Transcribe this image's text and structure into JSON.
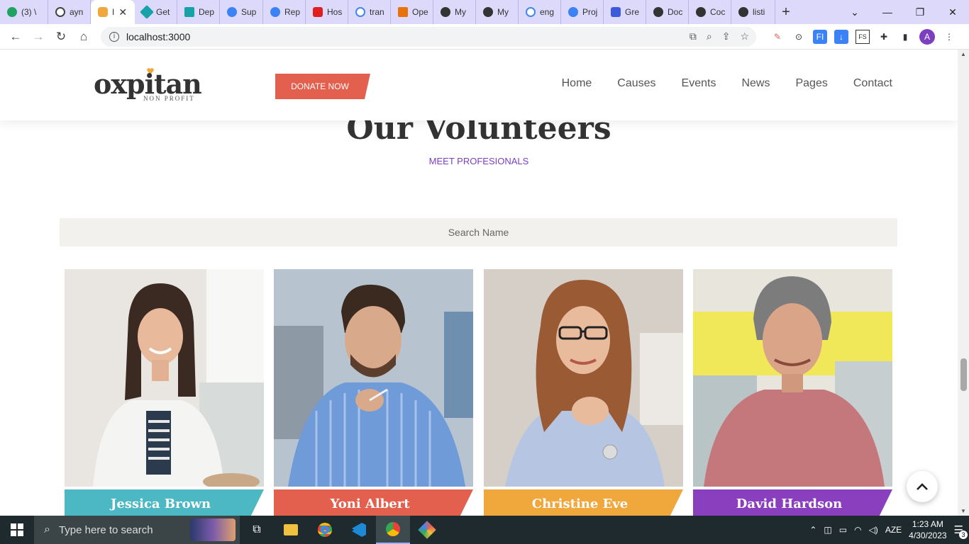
{
  "browser": {
    "tabs": [
      {
        "label": "(3) \\",
        "color": "#1ea362"
      },
      {
        "label": "ayn",
        "color": "#444444"
      },
      {
        "label": "I",
        "color": "#e4604e"
      },
      {
        "label": "Get",
        "color": "#17a2a8"
      },
      {
        "label": "Dep",
        "color": "#17a2a8"
      },
      {
        "label": "Sup",
        "color": "#3b82f6"
      },
      {
        "label": "Rep",
        "color": "#3b82f6"
      },
      {
        "label": "Hos",
        "color": "#e02020"
      },
      {
        "label": "tran",
        "color": "#4285f4"
      },
      {
        "label": "Ope",
        "color": "#e8710a"
      },
      {
        "label": "My",
        "color": "#333333"
      },
      {
        "label": "My",
        "color": "#333333"
      },
      {
        "label": "eng",
        "color": "#4285f4"
      },
      {
        "label": "Proj",
        "color": "#3b82f6"
      },
      {
        "label": "Gre",
        "color": "#3b5bdb"
      },
      {
        "label": "Doc",
        "color": "#333333"
      },
      {
        "label": "Coc",
        "color": "#333333"
      },
      {
        "label": "listi",
        "color": "#333333"
      }
    ],
    "url": "localhost:3000",
    "profile_initial": "A"
  },
  "site": {
    "logo_text": "oxpitan",
    "logo_sub": "NON PROFIT",
    "donate_label": "DONATE NOW",
    "nav": [
      "Home",
      "Causes",
      "Events",
      "News",
      "Pages",
      "Contact"
    ]
  },
  "section": {
    "title": "Our Volunteers",
    "subtitle": "MEET PROFESIONALS",
    "search_placeholder": "Search Name"
  },
  "volunteers": [
    {
      "name": "Jessica Brown",
      "color": "#4cb8c4"
    },
    {
      "name": "Yoni Albert",
      "color": "#e4604e"
    },
    {
      "name": "Christine Eve",
      "color": "#f0a83c"
    },
    {
      "name": "David Hardson",
      "color": "#8a3fbf"
    }
  ],
  "taskbar": {
    "search_placeholder": "Type here to search",
    "language": "AZE",
    "time": "1:23 AM",
    "date": "4/30/2023",
    "notification_count": "3"
  }
}
